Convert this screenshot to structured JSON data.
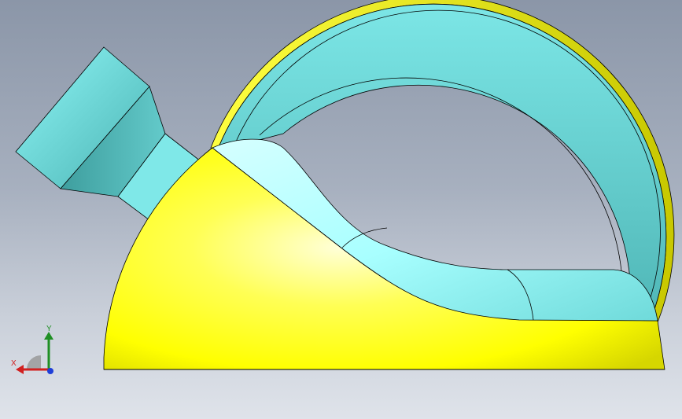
{
  "viewport": {
    "background_top": "#8b96a8",
    "background_bottom": "#dfe3ea"
  },
  "model": {
    "body_color": "#ffff00",
    "body_shade": "#c8c800",
    "handle_color": "#b4ffff",
    "handle_shade": "#4fbcbc",
    "edge_color": "#000000"
  },
  "triad": {
    "x_label": "X",
    "y_label": "Y",
    "x_color": "#d12020",
    "y_color": "#1f8f24",
    "z_color": "#1f3fd8"
  }
}
